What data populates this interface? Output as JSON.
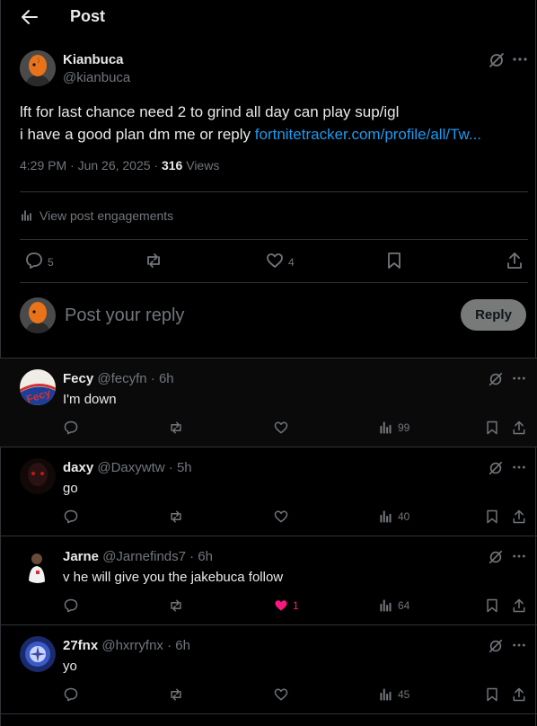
{
  "header": {
    "title": "Post"
  },
  "post": {
    "author_name": "Kianbuca",
    "author_handle": "@kianbuca",
    "text_line1": "lft for last chance need 2 to grind all day can play sup/igl",
    "text_line2_prefix": "i have a good plan dm me or reply ",
    "link_text": "fortnitetracker.com/profile/all/Tw...",
    "time": "4:29 PM · Jun 26, 2025 · ",
    "views_count": "316",
    "views_label": " Views",
    "engagements_label": "View post engagements",
    "replies": "5",
    "likes": "4"
  },
  "composer": {
    "placeholder": "Post your reply",
    "button": "Reply"
  },
  "replies": [
    {
      "name": "Fecy",
      "handle": "@fecyfn · 6h",
      "text": "I'm down",
      "likes": "",
      "views": "99",
      "liked": false,
      "avatar_text": "Fecy"
    },
    {
      "name": "daxy",
      "handle": "@Daxywtw · 5h",
      "text": "go",
      "likes": "",
      "views": "40",
      "liked": false
    },
    {
      "name": "Jarne",
      "handle": "@Jarnefinds7 · 6h",
      "text": "v he will give you the jakebuca follow",
      "likes": "1",
      "views": "64",
      "liked": true
    },
    {
      "name": "27fnx",
      "handle": "@hxrryfnx · 6h",
      "text": "yo",
      "likes": "",
      "views": "45",
      "liked": false
    }
  ],
  "colors": {
    "link": "#1d9bf0",
    "like_active": "#f91880",
    "muted": "#71767b"
  }
}
